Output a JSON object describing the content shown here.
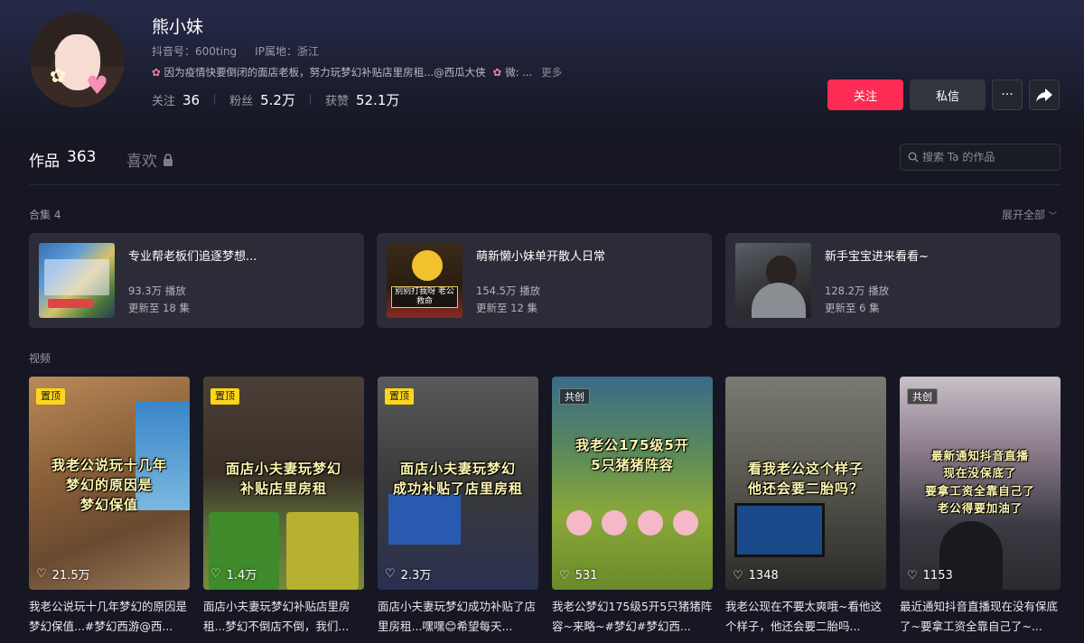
{
  "profile": {
    "name": "熊小妹",
    "douyin_id": "抖音号：600ting",
    "ip_location": "IP属地：浙江",
    "bio": "因为疫情快要倒闭的面店老板，努力玩梦幻补贴店里房租...@西瓜大侠",
    "bio_wechat": "微: ...",
    "bio_more": "更多",
    "stats": [
      {
        "label": "关注",
        "value": "36"
      },
      {
        "label": "粉丝",
        "value": "5.2万"
      },
      {
        "label": "获赞",
        "value": "52.1万"
      }
    ]
  },
  "actions": {
    "follow": "关注",
    "message": "私信",
    "more": "···"
  },
  "tabs": {
    "works_label": "作品",
    "works_count": "363",
    "likes_label": "喜欢"
  },
  "search": {
    "placeholder": "搜索 Ta 的作品"
  },
  "collections": {
    "label": "合集 4",
    "expand": "展开全部",
    "items": [
      {
        "title": "专业帮老板们追逐梦想...",
        "plays": "93.3万 播放",
        "updates": "更新至 18 集",
        "thumb_text": ""
      },
      {
        "title": "萌新懒小妹单开散人日常",
        "plays": "154.5万 播放",
        "updates": "更新至 12 集",
        "thumb_text": "别别打我呀 老公救命"
      },
      {
        "title": "新手宝宝进来看看~",
        "plays": "128.2万 播放",
        "updates": "更新至 6 集",
        "thumb_text": ""
      }
    ]
  },
  "videos": {
    "label": "视频",
    "items": [
      {
        "badge": "置顶",
        "caption": "我老公说玩十几年\n梦幻的原因是\n梦幻保值",
        "likes": "21.5万",
        "title": "我老公说玩十几年梦幻的原因是梦幻保值...#梦幻西游@西..."
      },
      {
        "badge": "置顶",
        "caption": "面店小夫妻玩梦幻\n补贴店里房租",
        "likes": "1.4万",
        "title": "面店小夫妻玩梦幻补贴店里房租...梦幻不倒店不倒，我们..."
      },
      {
        "badge": "置顶",
        "caption": "面店小夫妻玩梦幻\n成功补贴了店里房租",
        "likes": "2.3万",
        "title": "面店小夫妻玩梦幻成功补贴了店里房租...嘿嘿😊希望每天..."
      },
      {
        "badge": "共创",
        "caption": "我老公175级5开\n5只猪猪阵容",
        "likes": "531",
        "title": "我老公梦幻175级5开5只猪猪阵容~来略~#梦幻#梦幻西..."
      },
      {
        "badge": "",
        "caption": "看我老公这个样子\n他还会要二胎吗？",
        "likes": "1348",
        "title": "我老公现在不要太爽哦~看他这个样子，他还会要二胎吗..."
      },
      {
        "badge": "共创",
        "caption": "最新通知抖音直播\n现在没保底了\n要拿工资全靠自己了\n老公得要加油了",
        "likes": "1153",
        "title": "最近通知抖音直播现在没有保底了~要拿工资全靠自己了~..."
      }
    ]
  },
  "colors": {
    "accent": "#fe2c55",
    "pin_badge": "#fdd51c",
    "background": "#161722"
  }
}
